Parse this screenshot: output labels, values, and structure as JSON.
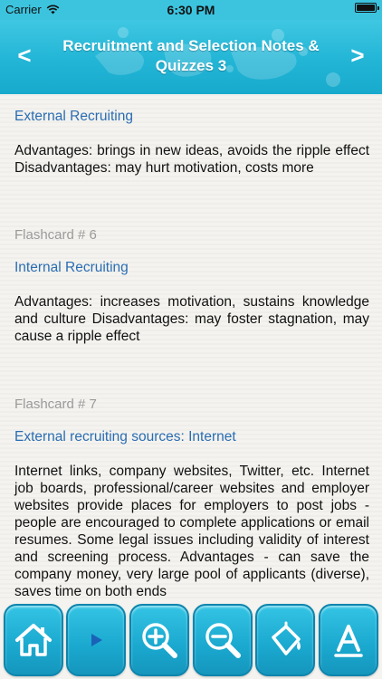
{
  "status_bar": {
    "carrier": "Carrier",
    "time": "6:30 PM"
  },
  "header": {
    "title": "Recruitment and Selection Notes & Quizzes 3",
    "prev_label": "<",
    "next_label": ">"
  },
  "cards": [
    {
      "term": "External Recruiting",
      "definition": "Advantages: brings in new ideas, avoids the ripple effect Disadvantages: may hurt motivation, costs more"
    },
    {
      "label": "Flashcard # 6",
      "term": "Internal Recruiting",
      "definition": "Advantages: increases motivation, sustains knowledge and culture Disadvantages: may foster stagnation, may cause a ripple effect"
    },
    {
      "label": "Flashcard # 7",
      "term": "External recruiting sources: Internet",
      "definition": "Internet links, company websites, Twitter, etc. Internet job boards, professional/career websites and employer websites provide places for employers to post jobs - people are encouraged to complete applications or email resumes. Some legal issues including validity of interest and screening process. Advantages - can save the company money, very large pool of applicants (diverse), saves time on both ends"
    }
  ],
  "toolbar": {
    "buttons": [
      "home-icon",
      "play-icon",
      "zoom-in-icon",
      "zoom-out-icon",
      "paint-bucket-icon",
      "font-icon"
    ]
  },
  "colors": {
    "header": "#22b5d6",
    "link_text": "#2a6db3",
    "muted_text": "#9a9a9a",
    "button": "#1aa8cf"
  }
}
